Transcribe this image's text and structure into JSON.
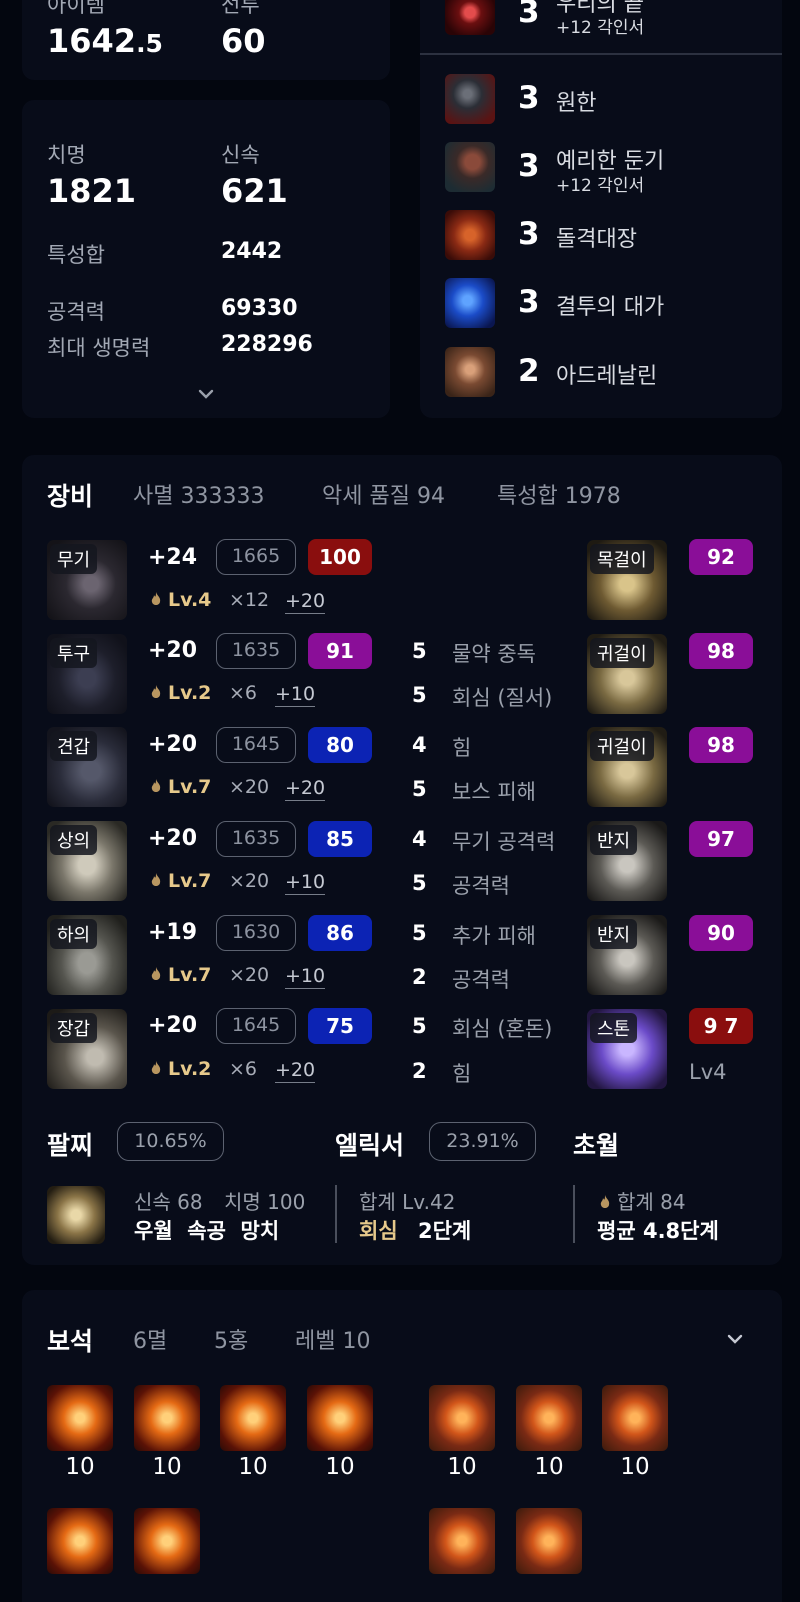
{
  "stats": {
    "item_level_label": "아이템",
    "item_level_main": "1642",
    "item_level_dec": ".5",
    "battle_label": "전투",
    "battle_value": "60",
    "crit_label": "치명",
    "crit_value": "1821",
    "swift_label": "신속",
    "swift_value": "621",
    "stat_sum_label": "특성합",
    "stat_sum_value": "2442",
    "attack_label": "공격력",
    "attack_value": "69330",
    "hp_label": "최대 생명력",
    "hp_value": "228296"
  },
  "engravings": [
    {
      "level": "3",
      "name": "우리의 끝",
      "sub": "+12 각인서",
      "icon": "blood-orb-icon"
    },
    {
      "level": "3",
      "name": "원한",
      "sub": "",
      "icon": "beast-head-icon"
    },
    {
      "level": "3",
      "name": "예리한 둔기",
      "sub": "+12 각인서",
      "icon": "spiked-mace-icon"
    },
    {
      "level": "3",
      "name": "돌격대장",
      "sub": "",
      "icon": "charging-warriors-icon"
    },
    {
      "level": "3",
      "name": "결투의 대가",
      "sub": "",
      "icon": "blue-duel-icon"
    },
    {
      "level": "2",
      "name": "아드레날린",
      "sub": "",
      "icon": "adrenaline-runner-icon"
    }
  ],
  "equipment": {
    "title": "장비",
    "tabs": [
      "사멸 333333",
      "악세 품질 94",
      "특성합 1978"
    ],
    "items": [
      {
        "slot": "무기",
        "upgrade": "+24",
        "ilvl": "1665",
        "quality": "100",
        "qcolor": "#8a0e0e",
        "lv": "Lv.4",
        "mult": "×12",
        "plus": "+20",
        "abilities": []
      },
      {
        "slot": "투구",
        "upgrade": "+20",
        "ilvl": "1635",
        "quality": "91",
        "qcolor": "#8a0e98",
        "lv": "Lv.2",
        "mult": "×6",
        "plus": "+10",
        "abilities": [
          {
            "n": "5",
            "name": "물약 중독"
          },
          {
            "n": "5",
            "name": "회심 (질서)"
          }
        ]
      },
      {
        "slot": "견갑",
        "upgrade": "+20",
        "ilvl": "1645",
        "quality": "80",
        "qcolor": "#0c23b4",
        "lv": "Lv.7",
        "mult": "×20",
        "plus": "+20",
        "abilities": [
          {
            "n": "4",
            "name": "힘"
          },
          {
            "n": "5",
            "name": "보스 피해"
          }
        ]
      },
      {
        "slot": "상의",
        "upgrade": "+20",
        "ilvl": "1635",
        "quality": "85",
        "qcolor": "#0c23b4",
        "lv": "Lv.7",
        "mult": "×20",
        "plus": "+10",
        "abilities": [
          {
            "n": "4",
            "name": "무기 공격력"
          },
          {
            "n": "5",
            "name": "공격력"
          }
        ]
      },
      {
        "slot": "하의",
        "upgrade": "+19",
        "ilvl": "1630",
        "quality": "86",
        "qcolor": "#0c23b4",
        "lv": "Lv.7",
        "mult": "×20",
        "plus": "+10",
        "abilities": [
          {
            "n": "5",
            "name": "추가 피해"
          },
          {
            "n": "2",
            "name": "공격력"
          }
        ]
      },
      {
        "slot": "장갑",
        "upgrade": "+20",
        "ilvl": "1645",
        "quality": "75",
        "qcolor": "#0c23b4",
        "lv": "Lv.2",
        "mult": "×6",
        "plus": "+20",
        "abilities": [
          {
            "n": "5",
            "name": "회심 (혼돈)"
          },
          {
            "n": "2",
            "name": "힘"
          }
        ]
      }
    ],
    "accessories": [
      {
        "slot": "목걸이",
        "quality": "92",
        "qcolor": "#8a0e98"
      },
      {
        "slot": "귀걸이",
        "quality": "98",
        "qcolor": "#8a0e98"
      },
      {
        "slot": "귀걸이",
        "quality": "98",
        "qcolor": "#8a0e98"
      },
      {
        "slot": "반지",
        "quality": "97",
        "qcolor": "#8a0e98"
      },
      {
        "slot": "반지",
        "quality": "90",
        "qcolor": "#8a0e98"
      },
      {
        "slot": "스톤",
        "quality": "9 7",
        "qcolor": "#8a0e0e",
        "extra": "Lv4"
      }
    ]
  },
  "bracelet": {
    "title": "팔찌",
    "percent": "10.65%",
    "stat1": "신속 68",
    "stat2": "치명 100",
    "effects": "우월  속공  망치"
  },
  "elixir": {
    "title": "엘릭서",
    "percent": "23.91%",
    "total": "합계 Lv.42",
    "effect": "회심",
    "stage": "2단계"
  },
  "transcend": {
    "title": "초월",
    "total": "합계 84",
    "avg": "평균 4.8단계"
  },
  "gems": {
    "title": "보석",
    "tab1": "6멸",
    "tab2": "5홍",
    "tab3": "레벨 10",
    "row1_left": [
      "10",
      "10",
      "10",
      "10"
    ],
    "row1_right": [
      "10",
      "10",
      "10"
    ]
  },
  "colors": {
    "background": "#03060f",
    "card": "#080c19",
    "gold": "#e6c98b",
    "quality_red": "#8a0e0e",
    "quality_purple": "#8a0e98",
    "quality_blue": "#0c23b4"
  }
}
